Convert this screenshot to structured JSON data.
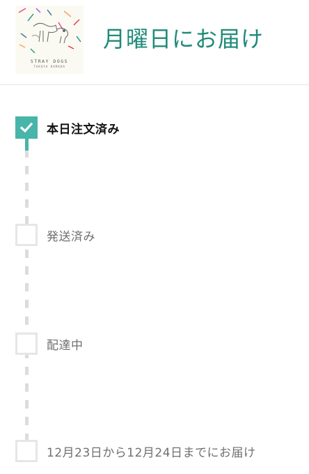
{
  "header": {
    "album": {
      "title": "STRAY DOGS",
      "artist": "TAKUYA KAMADA"
    },
    "delivery_title": "月曜日にお届け"
  },
  "timeline": {
    "steps": [
      {
        "label": "本日注文済み",
        "checked": true
      },
      {
        "label": "発送済み",
        "checked": false
      },
      {
        "label": "配達中",
        "checked": false
      },
      {
        "label": "12月23日から12月24日までにお届け",
        "checked": false
      }
    ]
  },
  "colors": {
    "accent": "#47b5a9",
    "title": "#1f8a78",
    "inactive_border": "#e6e6e6",
    "inactive_text": "#707070"
  },
  "icons": {
    "check": "check-icon"
  }
}
